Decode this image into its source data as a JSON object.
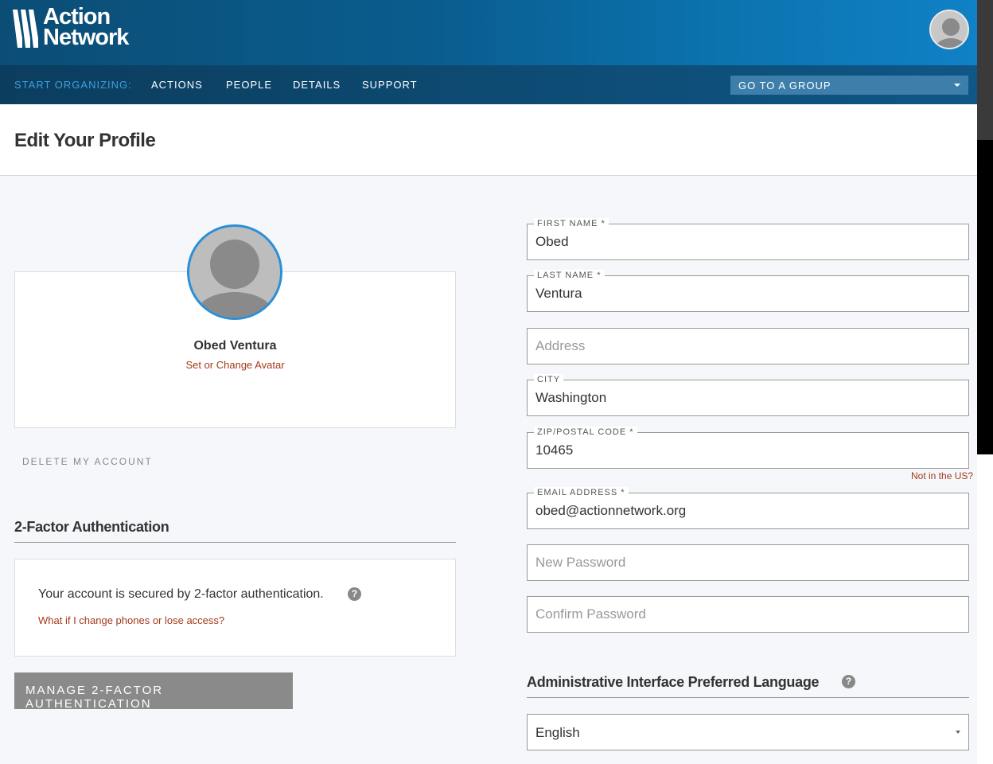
{
  "brand": {
    "line1": "Action",
    "line2": "Network"
  },
  "nav": {
    "start_label": "START ORGANIZING:",
    "items": [
      {
        "label": "ACTIONS"
      },
      {
        "label": "PEOPLE"
      },
      {
        "label": "DETAILS"
      },
      {
        "label": "SUPPORT"
      }
    ],
    "group_select": "GO TO A GROUP"
  },
  "page": {
    "title": "Edit Your Profile"
  },
  "profile": {
    "name": "Obed Ventura",
    "avatar_link": "Set or Change Avatar",
    "delete_link": "DELETE MY ACCOUNT"
  },
  "two_factor": {
    "heading": "2-Factor Authentication",
    "status_text": "Your account is secured by 2-factor authentication.",
    "help_glyph": "?",
    "help_link": "What if I change phones or lose access?",
    "manage_button": "MANAGE 2-FACTOR AUTHENTICATION"
  },
  "form": {
    "first_name": {
      "label": "FIRST NAME *",
      "value": "Obed"
    },
    "last_name": {
      "label": "LAST NAME *",
      "value": "Ventura"
    },
    "address": {
      "placeholder": "Address",
      "value": ""
    },
    "city": {
      "label": "CITY",
      "value": "Washington"
    },
    "zip": {
      "label": "ZIP/POSTAL CODE *",
      "value": "10465",
      "link": "Not in the US?"
    },
    "email": {
      "label": "EMAIL ADDRESS *",
      "value": "obed@actionnetwork.org"
    },
    "new_password": {
      "placeholder": "New Password"
    },
    "confirm_password": {
      "placeholder": "Confirm Password"
    }
  },
  "language": {
    "heading": "Administrative Interface Preferred Language",
    "help_glyph": "?",
    "selected": "English"
  },
  "colors": {
    "header": "#0b5d8f",
    "nav": "#0d4a72",
    "accent": "#2b8fd6",
    "link": "#a33a1a",
    "button": "#8a8a8a"
  }
}
